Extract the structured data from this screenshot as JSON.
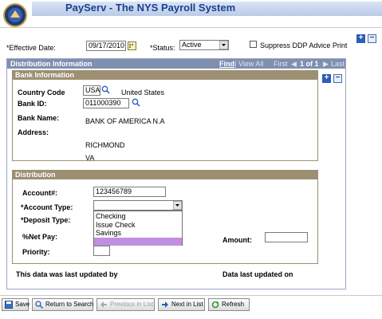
{
  "header": {
    "title": "PayServ - The NYS Payroll System"
  },
  "top_row": {
    "effective_date_label": "*Effective Date:",
    "effective_date_value": "09/17/2010",
    "status_label": "*Status:",
    "status_value": "Active",
    "suppress_label": "Suppress DDP Advice Print",
    "suppress_checked": false
  },
  "dist_info": {
    "title": "Distribution Information",
    "find_label": "Find",
    "sep": "|",
    "view_all_label": "View All",
    "first_label": "First",
    "counter": "1 of 1",
    "last_label": "Last"
  },
  "bank": {
    "title": "Bank Information",
    "country_label": "Country Code",
    "country_value": "USA",
    "country_name": "United States",
    "bank_id_label": "Bank ID:",
    "bank_id_value": "011000390",
    "bank_name_label": "Bank Name:",
    "bank_name_value": "BANK OF AMERICA N.A",
    "address_label": "Address:",
    "address_city": "RICHMOND",
    "address_state": "VA"
  },
  "distribution": {
    "title": "Distribution",
    "account_label": "Account#:",
    "account_value": "123456789",
    "account_type_label": "*Account Type:",
    "deposit_type_label": "*Deposit Type:",
    "net_pay_label": "%Net Pay:",
    "amount_label": "Amount:",
    "priority_label": "Priority:",
    "account_type_options": [
      "Checking",
      "Issue Check",
      "Savings",
      ""
    ]
  },
  "footer_info": {
    "updated_by_label": "This data was last updated by",
    "updated_on_label": "Data last updated on"
  },
  "toolbar": {
    "save": "Save",
    "return": "Return to Search",
    "previous": "Previous in List",
    "next": "Next in List",
    "refresh": "Refresh"
  },
  "colors": {
    "title_blue": "#1a3f8f",
    "section_header": "#9c8f72",
    "outer_header": "#7f8fb0",
    "selected_option": "#c08fe0"
  },
  "icons": [
    "nys-seal-icon",
    "calendar-icon",
    "dropdown-arrow-icon",
    "magnifier-icon",
    "plus-icon",
    "minus-icon",
    "save-icon",
    "return-icon",
    "previous-icon",
    "next-icon",
    "refresh-icon"
  ]
}
